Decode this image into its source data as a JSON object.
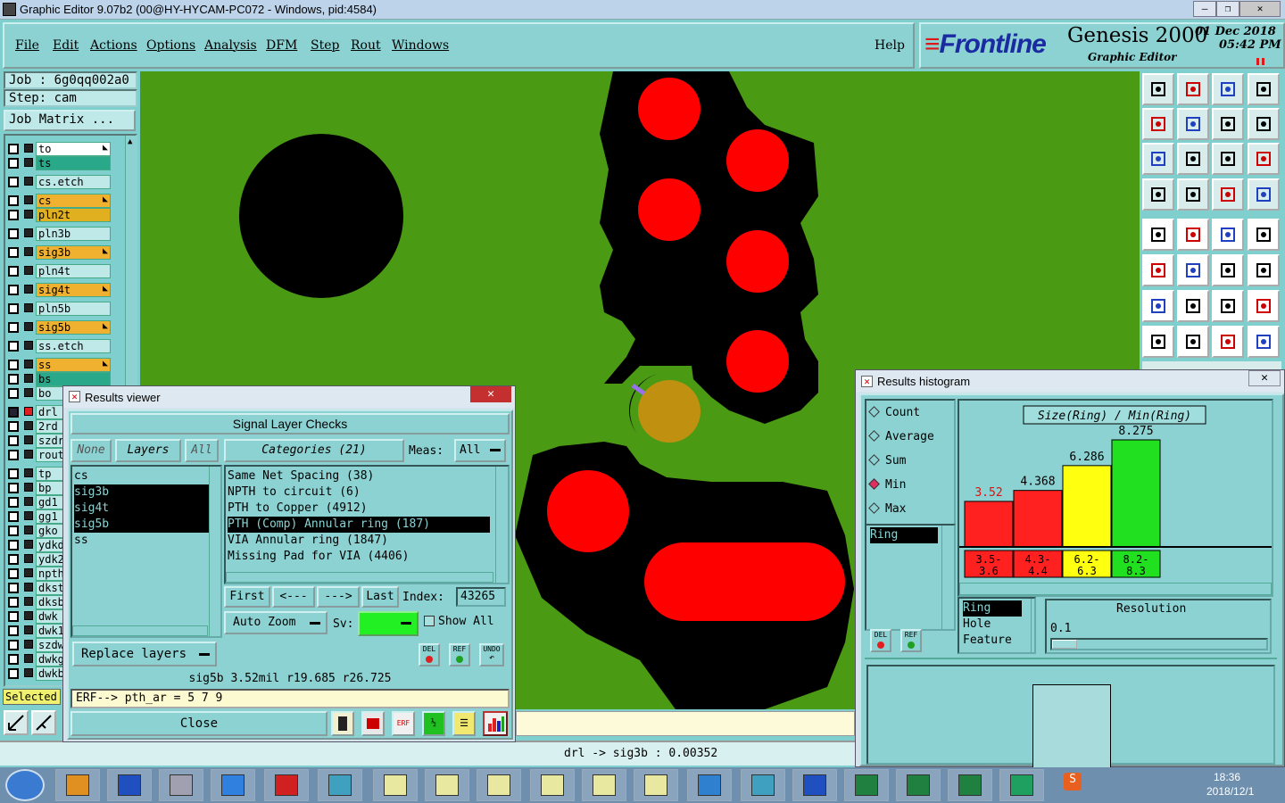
{
  "window": {
    "title": "Graphic Editor 9.07b2 (00@HY-HYCAM-PC072 - Windows, pid:4584)"
  },
  "menu": [
    "File",
    "Edit",
    "Actions",
    "Options",
    "Analysis",
    "DFM",
    "Step",
    "Rout",
    "Windows"
  ],
  "menu_help": "Help",
  "brand": {
    "logo": "Frontline",
    "product": "Genesis 2000",
    "sub": "Graphic Editor",
    "date": "01 Dec 2018",
    "time": "05:42 PM"
  },
  "job": {
    "job_label": "Job : 6g0qq002a0",
    "step_label": "Step: cam",
    "matrix_button": "Job Matrix ..."
  },
  "layers": [
    {
      "name": "to",
      "color": "#ffffff",
      "mark": true
    },
    {
      "name": "ts",
      "color": "#2aa88a",
      "mark": false
    },
    {
      "name": "cs.etch",
      "color": "#bfe8e8",
      "mark": false
    },
    {
      "name": "cs",
      "color": "#f0b030",
      "mark": true
    },
    {
      "name": "pln2t",
      "color": "#e0b020",
      "mark": false
    },
    {
      "name": "pln3b",
      "color": "#bfe8e8",
      "mark": false
    },
    {
      "name": "sig3b",
      "color": "#f0b030",
      "mark": true
    },
    {
      "name": "pln4t",
      "color": "#bfe8e8",
      "mark": false
    },
    {
      "name": "sig4t",
      "color": "#f0b030",
      "mark": true
    },
    {
      "name": "pln5b",
      "color": "#bfe8e8",
      "mark": false
    },
    {
      "name": "sig5b",
      "color": "#f0b030",
      "mark": true
    },
    {
      "name": "ss.etch",
      "color": "#bfe8e8",
      "mark": false
    },
    {
      "name": "ss",
      "color": "#f0b030",
      "mark": true
    },
    {
      "name": "bs",
      "color": "#2aa88a",
      "mark": false
    },
    {
      "name": "bo",
      "color": "#bfe8e8",
      "mark": false
    },
    {
      "name": "drl",
      "color": "#bfe8e8",
      "mark": false
    },
    {
      "name": "2rd",
      "color": "#bfe8e8",
      "mark": false
    },
    {
      "name": "szdr",
      "color": "#bfe8e8",
      "mark": false
    },
    {
      "name": "rout",
      "color": "#bfe8e8",
      "mark": false
    },
    {
      "name": "tp",
      "color": "#bfe8e8",
      "mark": false
    },
    {
      "name": "bp",
      "color": "#bfe8e8",
      "mark": false
    },
    {
      "name": "gd1",
      "color": "#bfe8e8",
      "mark": false
    },
    {
      "name": "gg1",
      "color": "#bfe8e8",
      "mark": false
    },
    {
      "name": "gko",
      "color": "#bfe8e8",
      "mark": false
    },
    {
      "name": "ydkd",
      "color": "#bfe8e8",
      "mark": false
    },
    {
      "name": "ydk2",
      "color": "#bfe8e8",
      "mark": false
    },
    {
      "name": "npth",
      "color": "#bfe8e8",
      "mark": false
    },
    {
      "name": "dkst",
      "color": "#bfe8e8",
      "mark": false
    },
    {
      "name": "dksb",
      "color": "#bfe8e8",
      "mark": false
    },
    {
      "name": "dwk",
      "color": "#bfe8e8",
      "mark": false
    },
    {
      "name": "dwk1",
      "color": "#bfe8e8",
      "mark": false
    },
    {
      "name": "szdw",
      "color": "#bfe8e8",
      "mark": false
    },
    {
      "name": "dwkg",
      "color": "#bfe8e8",
      "mark": false
    },
    {
      "name": "dwkb",
      "color": "#bfe8e8",
      "mark": false
    }
  ],
  "selected_label": "Selected",
  "status_line": "drl -> sig3b : 0.00352",
  "results_viewer": {
    "title": "Results viewer",
    "heading": "Signal Layer Checks",
    "none": "None",
    "layers": "Layers",
    "all": "All",
    "categories_label": "Categories (21)",
    "meas_label": "Meas:",
    "meas_value": "All",
    "layer_list": [
      "cs",
      "sig3b",
      "sig4t",
      "sig5b",
      "ss"
    ],
    "categories": [
      "Same Net Spacing (38)",
      "NPTH to circuit (6)",
      "PTH to Copper (4912)",
      "PTH (Comp) Annular ring (187)",
      "VIA Annular ring (1847)",
      "Missing Pad for VIA (4406)"
    ],
    "nav": [
      "First",
      "<---",
      "--->",
      "Last"
    ],
    "index_label": "Index:",
    "index_value": "43265",
    "auto_zoom": "Auto Zoom",
    "sv_label": "Sv:",
    "show_all": "Show All",
    "replace_layers": "Replace layers",
    "del": "DEL",
    "ref": "REF",
    "undo": "UNDO",
    "info": "sig5b 3.52mil   r19.685   r26.725",
    "erf": "ERF--> pth_ar = 5 7 9",
    "close": "Close"
  },
  "histogram": {
    "title": "Results histogram",
    "modes": [
      "Count",
      "Average",
      "Sum",
      "Min",
      "Max"
    ],
    "mode_selected": "Min",
    "list": [
      "Ring"
    ],
    "chart_title": "Size(Ring) / Min(Ring)",
    "del": "DEL",
    "ref": "REF",
    "type_list": [
      "Ring",
      "Hole",
      "Feature"
    ],
    "resolution_label": "Resolution",
    "resolution_value": "0.1",
    "chart_data": {
      "type": "bar",
      "categories": [
        "3.5-3.6",
        "4.3-4.4",
        "6.2-6.3",
        "8.2-8.3"
      ],
      "values": [
        3.52,
        4.368,
        6.286,
        8.275
      ],
      "value_labels": [
        "3.52",
        "4.368",
        "6.286",
        "8.275"
      ],
      "colors": [
        "#ff2020",
        "#ff2020",
        "#ffff10",
        "#20e020"
      ],
      "bin_labels": [
        [
          "3.5-",
          "3.6"
        ],
        [
          "4.3-",
          "4.4"
        ],
        [
          "6.2-",
          "6.3"
        ],
        [
          "8.2-",
          "8.3"
        ]
      ]
    }
  },
  "tray": {
    "time": "18:36",
    "date": "2018/12/1"
  }
}
